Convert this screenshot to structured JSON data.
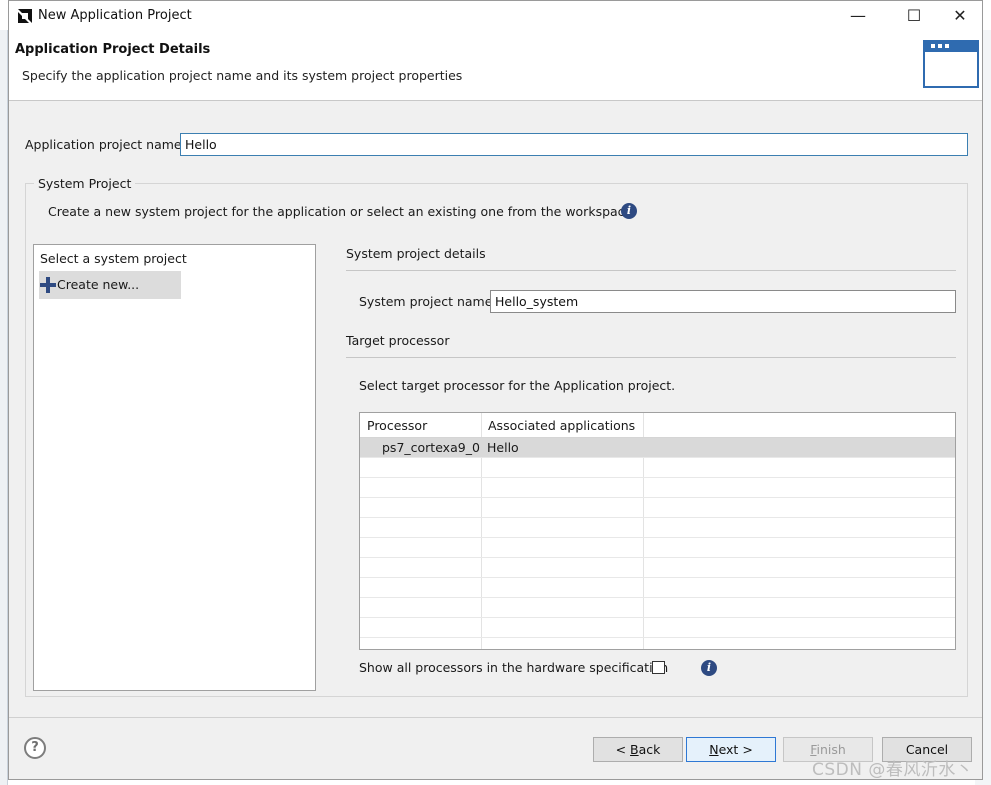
{
  "window": {
    "title": "New Application Project",
    "minimize_glyph": "—",
    "maximize_glyph": "☐",
    "close_glyph": "✕"
  },
  "header": {
    "title": "Application Project Details",
    "subtitle": "Specify the application project name and its system project properties",
    "icon": "wizard-window-icon"
  },
  "app_project": {
    "label": "Application project name:",
    "value": "Hello"
  },
  "system_project": {
    "legend": "System Project",
    "description": "Create a new system project for the application or select an existing one from the workspace",
    "list_header": "Select a system project",
    "list_items": [
      "Create new..."
    ],
    "details_title": "System project details",
    "name_label": "System project name:",
    "name_value": "Hello_system",
    "target_title": "Target processor",
    "target_description": "Select target processor for the Application project.",
    "table": {
      "columns": [
        "Processor",
        "Associated applications"
      ],
      "rows": [
        {
          "processor": "ps7_cortexa9_0",
          "apps": "Hello",
          "selected": true
        }
      ]
    },
    "show_all_label": "Show all processors in the hardware specification",
    "show_all_checked": false
  },
  "footer": {
    "help": "?",
    "back": {
      "prefix": "< ",
      "mnemonic": "B",
      "rest": "ack"
    },
    "next": {
      "mnemonic": "N",
      "rest": "ext",
      "suffix": " >"
    },
    "finish": {
      "mnemonic": "F",
      "rest": "inish"
    },
    "cancel": "Cancel"
  },
  "watermark": "CSDN @春风沂水丶",
  "colors": {
    "accent_blue": "#2e4a82",
    "focus_border": "#3c7fb1",
    "selection": "#d9d9d9",
    "dialog_bg": "#f0f0f0"
  }
}
